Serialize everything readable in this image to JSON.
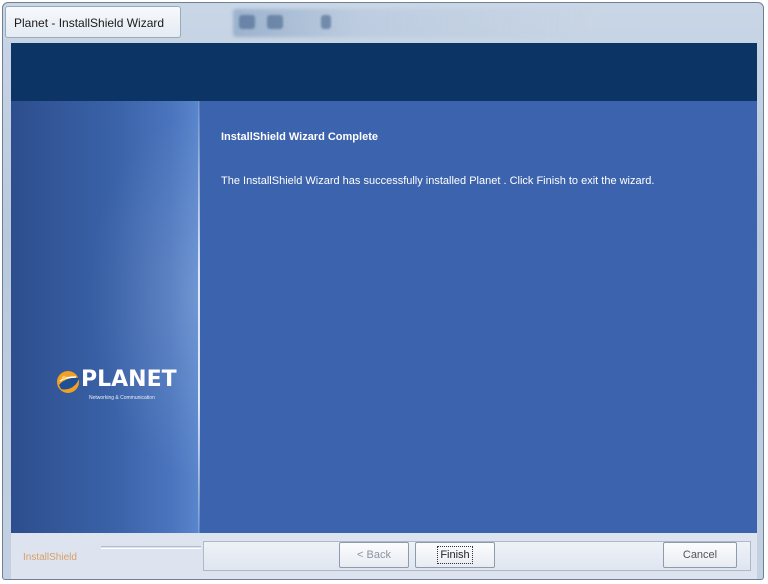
{
  "window": {
    "title": "Planet  - InstallShield Wizard"
  },
  "wizard": {
    "heading": "InstallShield Wizard Complete",
    "message": "The InstallShield Wizard has successfully installed Planet .  Click Finish to exit the wizard."
  },
  "logo": {
    "name": "PLANET",
    "tagline": "Networking & Communication",
    "icon": "planet-globe-icon"
  },
  "footer": {
    "brand": "InstallShield"
  },
  "buttons": {
    "back": "< Back",
    "finish": "Finish",
    "cancel": "Cancel"
  },
  "colors": {
    "content_background": "#3c63ad",
    "header_band": "#0c3464",
    "logo_accent": "#f0a022"
  }
}
